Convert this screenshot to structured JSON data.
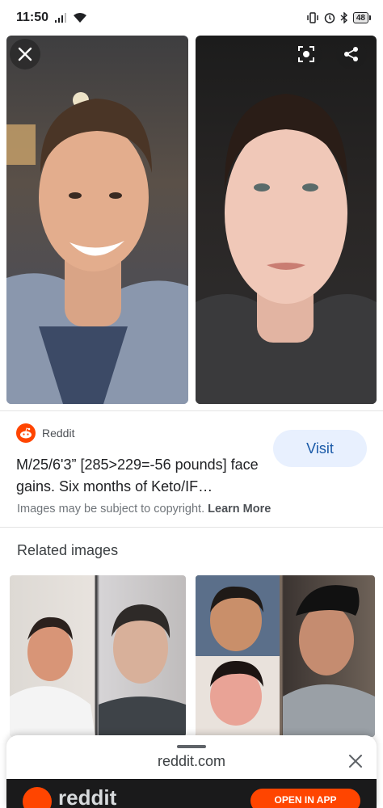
{
  "status_bar": {
    "time": "11:50",
    "battery_level": "48"
  },
  "viewer": {
    "close_icon": "close-icon",
    "lens_icon": "lens-icon",
    "share_icon": "share-icon"
  },
  "source": {
    "site_name": "Reddit",
    "visit_label": "Visit",
    "title": "M/25/6'3” [285>229=-56 pounds] face gains. Six months of Keto/IF…"
  },
  "copyright": {
    "notice": "Images may be subject to copyright.",
    "learn_more": "Learn More"
  },
  "related": {
    "heading": "Related images"
  },
  "bottom_sheet": {
    "url": "reddit.com",
    "preview_brand": "reddit",
    "preview_button": "OPEN IN APP"
  },
  "colors": {
    "accent": "#1a5aa8",
    "visit_bg": "#e8f0fe",
    "reddit_orange": "#ff4500"
  }
}
